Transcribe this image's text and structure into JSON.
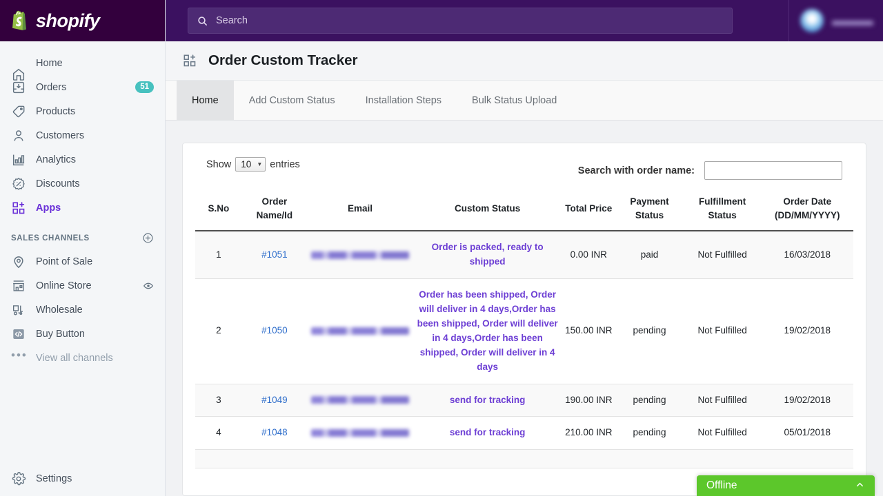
{
  "brand": {
    "name": "shopify",
    "logo_icon": "shopify-bag-icon",
    "bar_color": "#33003d"
  },
  "topbar": {
    "search_placeholder": "Search",
    "search_icon": "search-icon",
    "account_name_redacted": "",
    "account_sub_redacted": ""
  },
  "sidebar": {
    "items": [
      {
        "label": "Home",
        "icon": "home-icon",
        "active": false
      },
      {
        "label": "Orders",
        "icon": "orders-inbox-icon",
        "active": false,
        "badge": "51"
      },
      {
        "label": "Products",
        "icon": "tag-icon",
        "active": false
      },
      {
        "label": "Customers",
        "icon": "person-icon",
        "active": false
      },
      {
        "label": "Analytics",
        "icon": "bar-chart-icon",
        "active": false
      },
      {
        "label": "Discounts",
        "icon": "discount-percent-icon",
        "active": false
      },
      {
        "label": "Apps",
        "icon": "apps-grid-icon",
        "active": true
      }
    ],
    "section_title": "SALES CHANNELS",
    "section_add_icon": "plus-circle-icon",
    "channels": [
      {
        "label": "Point of Sale",
        "icon": "location-pin-icon"
      },
      {
        "label": "Online Store",
        "icon": "storefront-icon",
        "trailing_icon": "eye-icon"
      },
      {
        "label": "Wholesale",
        "icon": "forklift-icon"
      },
      {
        "label": "Buy Button",
        "icon": "code-brackets-icon"
      },
      {
        "label": "View all channels",
        "icon": "ellipsis-icon",
        "muted": true
      }
    ],
    "settings": {
      "label": "Settings",
      "icon": "gear-icon"
    }
  },
  "page": {
    "title": "Order Custom Tracker",
    "title_icon": "apps-grid-icon"
  },
  "tabs": [
    {
      "label": "Home",
      "active": true
    },
    {
      "label": "Add Custom Status",
      "active": false
    },
    {
      "label": "Installation Steps",
      "active": false
    },
    {
      "label": "Bulk Status Upload",
      "active": false
    }
  ],
  "controls": {
    "show_prefix": "Show",
    "show_value": "10",
    "show_suffix": "entries",
    "select_caret_icon": "caret-down-icon",
    "search_label": "Search with order name:",
    "search_value": "",
    "search_placeholder": ""
  },
  "table": {
    "columns": [
      "S.No",
      "Order Name/Id",
      "Email",
      "Custom Status",
      "Total Price",
      "Payment Status",
      "Fulfillment Status",
      "Order Date (DD/MM/YYYY)"
    ],
    "rows": [
      {
        "sno": "1",
        "order_name": "#1051",
        "email": "",
        "custom_status": "Order is packed, ready to shipped",
        "total_price": "0.00 INR",
        "payment_status": "paid",
        "fulfillment_status": "Not Fulfilled",
        "order_date": "16/03/2018"
      },
      {
        "sno": "2",
        "order_name": "#1050",
        "email": "",
        "custom_status": "Order has been shipped, Order will deliver in 4 days,Order has been shipped, Order will deliver in 4 days,Order has been shipped, Order will deliver in 4 days",
        "total_price": "150.00 INR",
        "payment_status": "pending",
        "fulfillment_status": "Not Fulfilled",
        "order_date": "19/02/2018"
      },
      {
        "sno": "3",
        "order_name": "#1049",
        "email": "",
        "custom_status": "send for tracking",
        "total_price": "190.00 INR",
        "payment_status": "pending",
        "fulfillment_status": "Not Fulfilled",
        "order_date": "19/02/2018"
      },
      {
        "sno": "4",
        "order_name": "#1048",
        "email": "",
        "custom_status": "send for tracking",
        "total_price": "210.00 INR",
        "payment_status": "pending",
        "fulfillment_status": "Not Fulfilled",
        "order_date": "05/01/2018"
      }
    ]
  },
  "chat_widget": {
    "label": "Offline",
    "caret_icon": "chevron-up-icon",
    "color": "#5cc72b"
  },
  "colors": {
    "accent_purple": "#6A31D8",
    "status_text": "#6d3fd4",
    "link_blue": "#2f6ecb",
    "badge_teal": "#47c1bf",
    "topbar_purple": "#3b1160",
    "logo_bar": "#33003d"
  }
}
